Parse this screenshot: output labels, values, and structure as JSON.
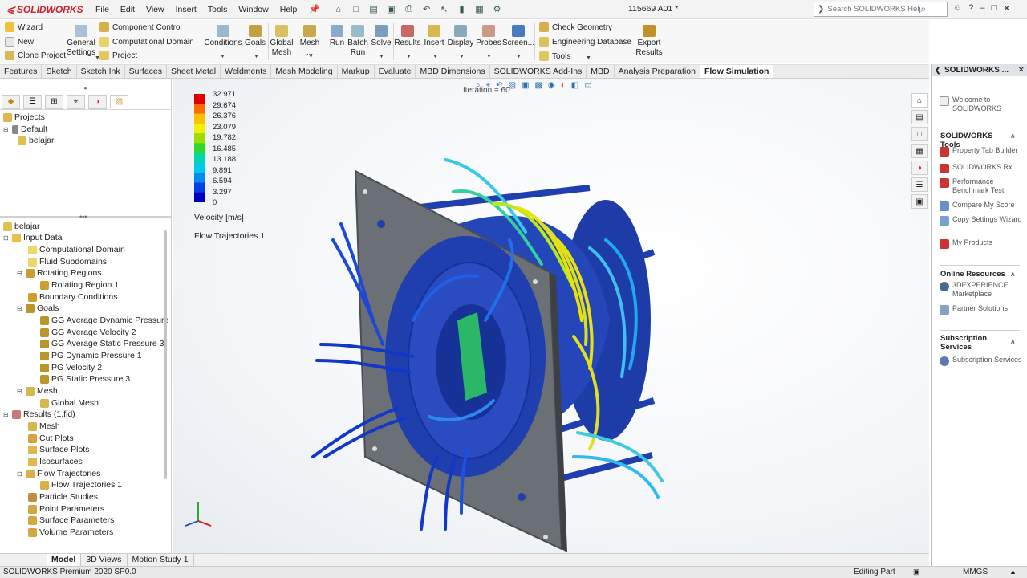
{
  "app": {
    "brand": "SOLIDWORKS",
    "document_title": "115669 A01 *",
    "search_placeholder": "Search SOLIDWORKS Help"
  },
  "menu": [
    "File",
    "Edit",
    "View",
    "Insert",
    "Tools",
    "Window",
    "Help"
  ],
  "ribbon": {
    "wizard": "Wizard",
    "new": "New",
    "clone_project": "Clone Project",
    "general_settings": "General Settings",
    "component_control": "Component Control",
    "computational_domain": "Computational Domain",
    "project": "Project",
    "conditions": "Conditions",
    "goals": "Goals",
    "global_mesh": "Global Mesh",
    "mesh": "Mesh ...",
    "run": "Run",
    "batch_run": "Batch Run",
    "solve": "Solve",
    "results": "Results",
    "insert": "Insert",
    "display": "Display",
    "probes": "Probes",
    "screen": "Screen...",
    "check_geometry": "Check Geometry",
    "engineering_database": "Engineering Database",
    "tools": "Tools",
    "export_results": "Export Results"
  },
  "tabs": [
    "Features",
    "Sketch",
    "Sketch Ink",
    "Surfaces",
    "Sheet Metal",
    "Weldments",
    "Mesh Modeling",
    "Markup",
    "Evaluate",
    "MBD Dimensions",
    "SOLIDWORKS Add-Ins",
    "MBD",
    "Analysis Preparation",
    "Flow Simulation"
  ],
  "active_tab": "Flow Simulation",
  "projects_tree": {
    "root": "Projects",
    "default": "Default",
    "item": "belajar"
  },
  "analysis_tree": {
    "root": "belajar",
    "input_data": "Input Data",
    "computational_domain": "Computational Domain",
    "fluid_subdomains": "Fluid Subdomains",
    "rotating_regions": "Rotating Regions",
    "rotating_region_1": "Rotating Region 1",
    "boundary_conditions": "Boundary Conditions",
    "goals": "Goals",
    "goal_items": [
      "GG Average Dynamic Pressure",
      "GG Average Velocity 2",
      "GG Average Static Pressure 3",
      "PG Dynamic Pressure 1",
      "PG Velocity 2",
      "PG Static Pressure 3"
    ],
    "mesh": "Mesh",
    "global_mesh": "Global Mesh",
    "results": "Results (1.fld)",
    "results_items": [
      "Mesh",
      "Cut Plots",
      "Surface Plots",
      "Isosurfaces"
    ],
    "flow_trajectories": "Flow Trajectories",
    "flow_trajectories_1": "Flow Trajectories 1",
    "results_items_2": [
      "Particle Studies",
      "Point Parameters",
      "Surface Parameters",
      "Volume Parameters"
    ]
  },
  "viewport": {
    "iteration_text": "Iteration = 60",
    "legend_title": "Velocity [m/s]",
    "trajectory_label": "Flow Trajectories 1",
    "legend_values": [
      "32.971",
      "29.674",
      "26.376",
      "23.079",
      "19.782",
      "16.485",
      "13.188",
      "9.891",
      "6.594",
      "3.297",
      "0"
    ],
    "legend_colors": [
      "#e00000",
      "#ff6a00",
      "#ffc000",
      "#f0f000",
      "#9ade00",
      "#2ed82e",
      "#00d8a8",
      "#00c8f0",
      "#008cf0",
      "#0040e8",
      "#0000c0"
    ]
  },
  "bottom_tabs": [
    "Model",
    "3D Views",
    "Motion Study 1"
  ],
  "status": {
    "left": "SOLIDWORKS Premium 2020 SP0.0",
    "mode": "Editing Part",
    "units": "MMGS"
  },
  "task_pane": {
    "title": "SOLIDWORKS ...",
    "welcome": "Welcome to SOLIDWORKS",
    "tools_heading": "SOLIDWORKS Tools",
    "tools": [
      "Property Tab Builder",
      "SOLIDWORKS Rx",
      "Performance Benchmark Test",
      "Compare My Score",
      "Copy Settings Wizard",
      "My Products"
    ],
    "online_heading": "Online Resources",
    "online": [
      "3DEXPERIENCE Marketplace",
      "Partner Solutions"
    ],
    "subscription_heading": "Subscription Services",
    "subscription": [
      "Subscription Services"
    ]
  },
  "colors": {
    "brand_red": "#d0202e",
    "model_blue": "#1f3fae",
    "plate_gray": "#6b6f76"
  }
}
